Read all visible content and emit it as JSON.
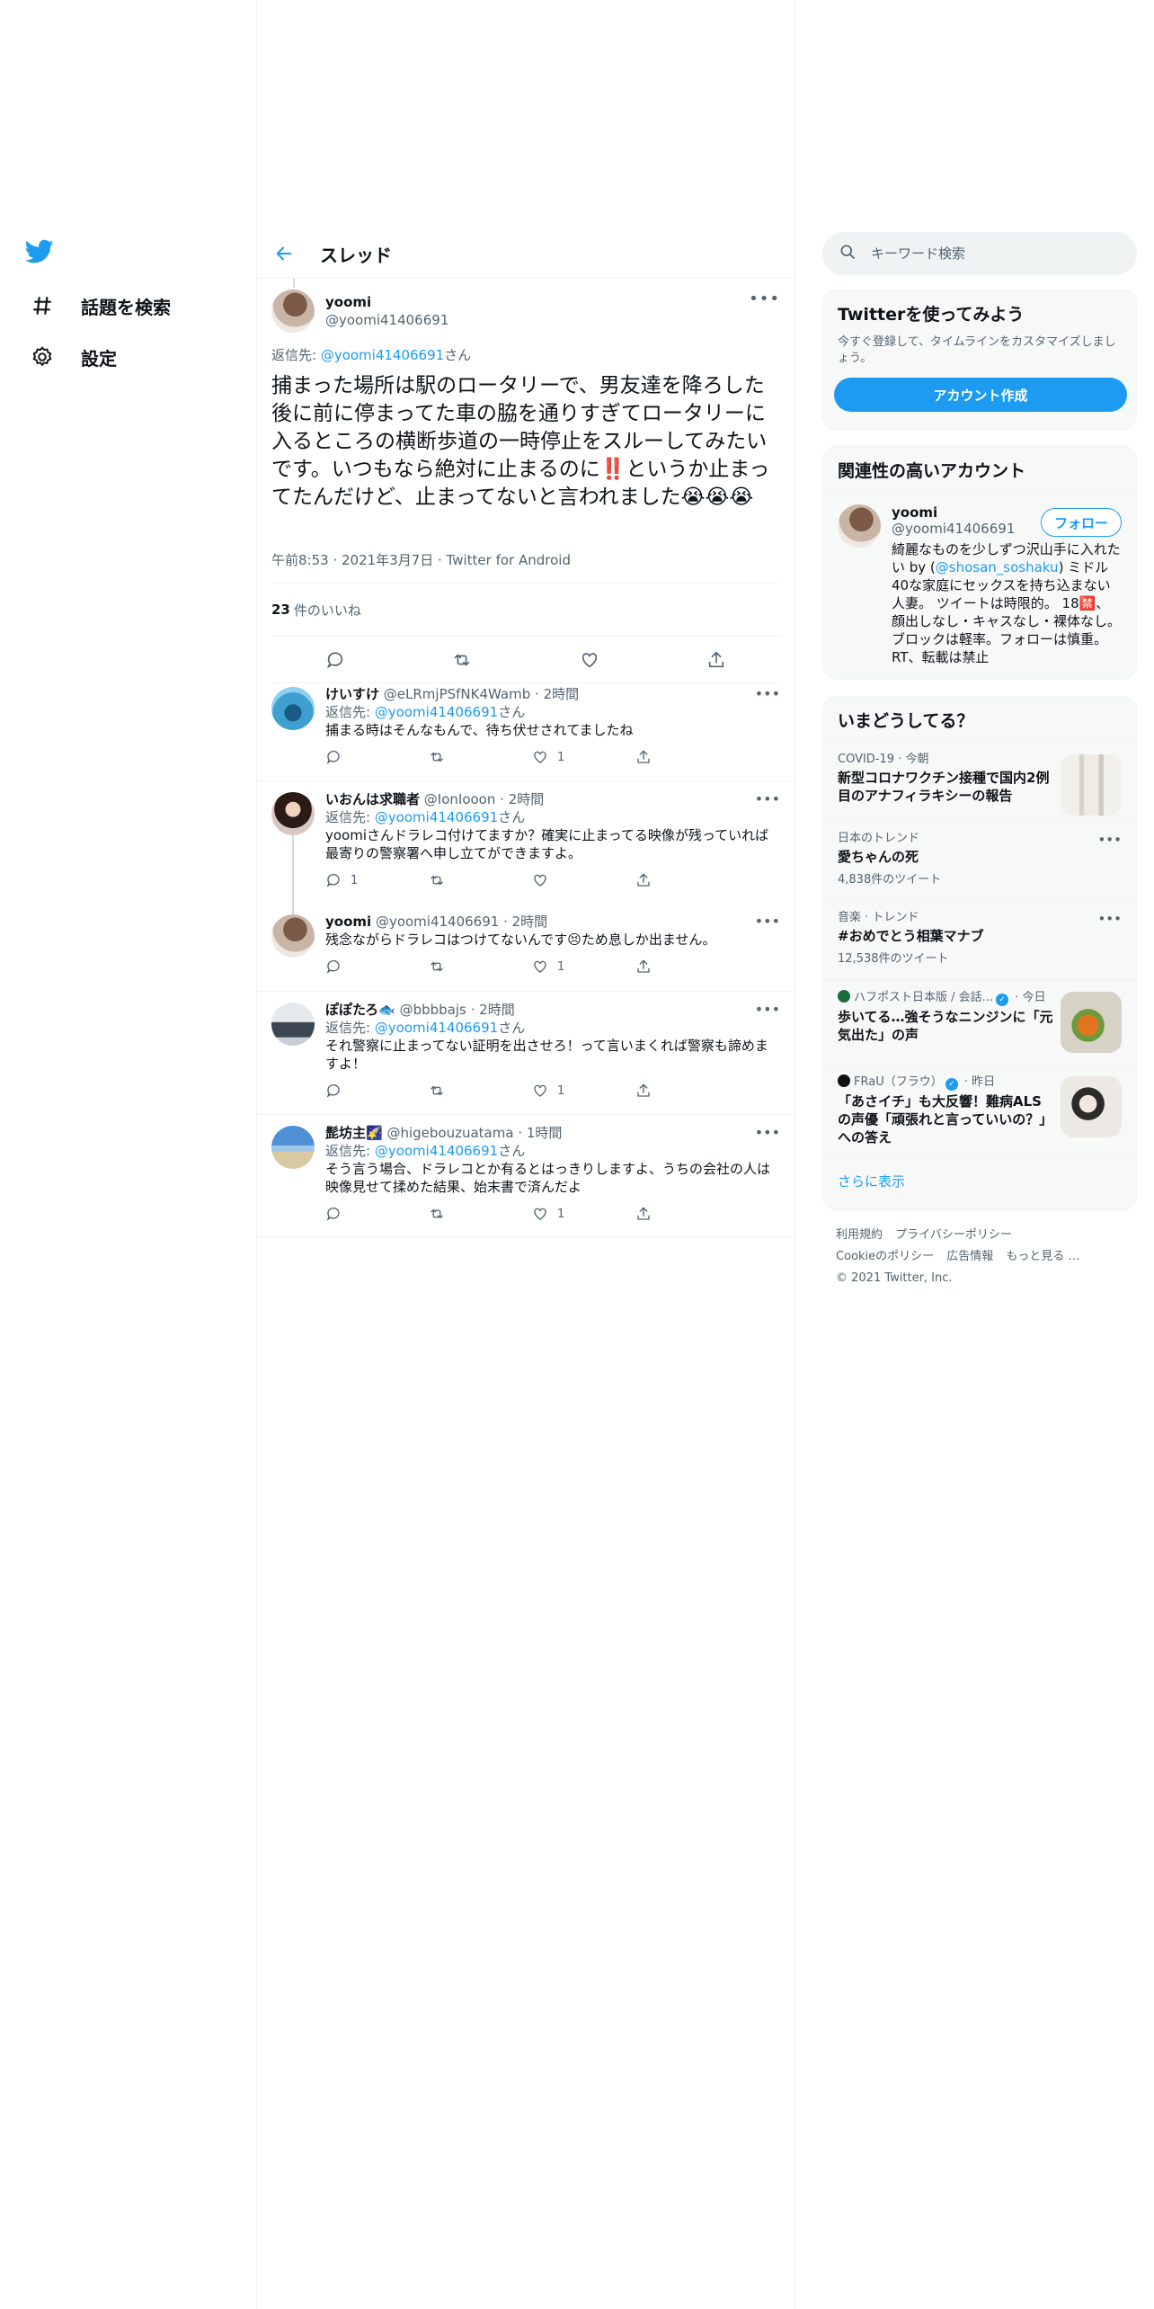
{
  "nav": {
    "explore_label": "話題を検索",
    "settings_label": "設定"
  },
  "thread": {
    "title": "スレッド"
  },
  "main_tweet": {
    "name": "yoomi",
    "handle": "@yoomi41406691",
    "reply_prefix": "返信先: ",
    "reply_to": "@yoomi41406691",
    "reply_suffix": "さん",
    "body": "捕まった場所は駅のロータリーで、男友達を降ろした後に前に停まってた車の脇を通りすぎてロータリーに入るところの横断歩道の一時停止をスルーしてみたいです。いつもなら絶対に止まるのに‼️というか止まってたんだけど、止まってないと言われました😭😭😭",
    "meta": "午前8:53 · 2021年3月7日 · Twitter for Android",
    "likes_count": "23",
    "likes_label": "件のいいね"
  },
  "replies": [
    {
      "name": "けいすけ",
      "handle": "@eLRmjPSfNK4Wamb",
      "time": "2時間",
      "reply_prefix": "返信先: ",
      "reply_to": "@yoomi41406691",
      "reply_suffix": "さん",
      "text": "捕まる時はそんなもんで、待ち伏せされてましたね",
      "replies": "",
      "retweets": "",
      "likes": "1"
    },
    {
      "name": "いおんは求職者",
      "handle": "@IonIooon",
      "time": "2時間",
      "reply_prefix": "返信先: ",
      "reply_to": "@yoomi41406691",
      "reply_suffix": "さん",
      "text": "yoomiさんドラレコ付けてますか？確実に止まってる映像が残っていれば最寄りの警察署へ申し立てができますよ。",
      "replies": "1",
      "retweets": "",
      "likes": ""
    },
    {
      "name": "yoomi",
      "handle": "@yoomi41406691",
      "time": "2時間",
      "reply_prefix": "",
      "reply_to": "",
      "reply_suffix": "",
      "text": "残念ながらドラレコはつけてないんです😣ため息しか出ません。",
      "replies": "",
      "retweets": "",
      "likes": "1"
    },
    {
      "name": "ぽぽたろ🐟",
      "handle": "@bbbbajs",
      "time": "2時間",
      "reply_prefix": "返信先: ",
      "reply_to": "@yoomi41406691",
      "reply_suffix": "さん",
      "text": "それ警察に止まってない証明を出させろ！って言いまくれば警察も諦めますよ！",
      "replies": "",
      "retweets": "",
      "likes": "1"
    },
    {
      "name": "髭坊主🌠",
      "handle": "@higebouzuatama",
      "time": "1時間",
      "reply_prefix": "返信先: ",
      "reply_to": "@yoomi41406691",
      "reply_suffix": "さん",
      "text": "そう言う場合、ドラレコとか有るとはっきりしますよ、うちの会社の人は映像見せて揉めた結果、始末書で済んだよ",
      "replies": "",
      "retweets": "",
      "likes": "1"
    }
  ],
  "search": {
    "placeholder": "キーワード検索"
  },
  "signup": {
    "title": "Twitterを使ってみよう",
    "desc": "今すぐ登録して、タイムラインをカスタマイズしましょう。",
    "button": "アカウント作成"
  },
  "related": {
    "title": "関連性の高いアカウント",
    "name": "yoomi",
    "handle": "@yoomi41406691",
    "follow_label": "フォロー",
    "bio_before": "綺麗なものを少しずつ沢山手に入れたい by (",
    "bio_link": "@shosan_soshaku",
    "bio_after": ") ミドル40な家庭にセックスを持ち込まない人妻。 ツイートは時限的。 18🈲、顔出しなし・キャスなし・裸体なし。ブロックは軽率。フォローは慎重。RT、転載は禁止"
  },
  "trends": {
    "title": "いまどうしてる？",
    "items": [
      {
        "meta": "COVID-19 · 今朝",
        "title": "新型コロナワクチン接種で国内2例目のアナフィラキシーの報告",
        "count": ""
      },
      {
        "meta": "日本のトレンド",
        "title": "愛ちゃんの死",
        "count": "4,838件のツイート"
      },
      {
        "meta": "音楽 · トレンド",
        "title": "#おめでとう相葉マナブ",
        "count": "12,538件のツイート"
      },
      {
        "meta_source": "ハフポスト日本版 / 会話...",
        "meta_time": " · 今日",
        "title": "歩いてる…強そうなニンジンに「元気出た」の声",
        "count": ""
      },
      {
        "meta_source": "FRaU（フラウ）",
        "meta_time": " · 昨日",
        "title": "「あさイチ」も大反響！難病ALSの声優「頑張れと言っていいの？」への答え",
        "count": ""
      }
    ],
    "show_more": "さらに表示"
  },
  "footer": {
    "links": [
      "利用規約",
      "プライバシーポリシー",
      "Cookieのポリシー",
      "広告情報",
      "もっと見る …"
    ],
    "copyright": "© 2021 Twitter, Inc."
  },
  "colors": {
    "accent": "#1d9bf0",
    "text": "#0f1419",
    "muted": "#536471",
    "border": "#eff3f4"
  }
}
